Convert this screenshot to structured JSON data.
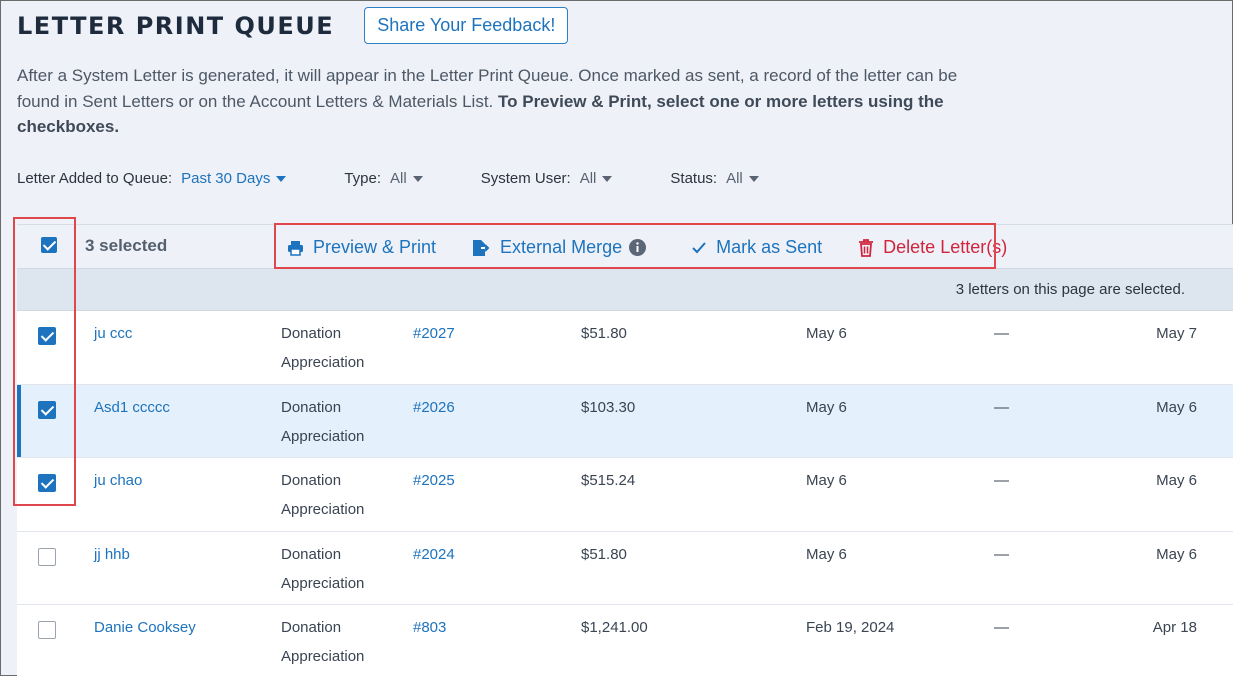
{
  "header": {
    "title": "LETTER PRINT QUEUE",
    "feedback_label": "Share Your Feedback!"
  },
  "description": {
    "text": "After a System Letter is generated, it will appear in the Letter Print Queue. Once marked as sent, a record of the letter can be found in Sent Letters or on the Account Letters & Materials List. ",
    "bold": "To Preview & Print, select one or more letters using the checkboxes."
  },
  "filters": [
    {
      "label": "Letter Added to Queue:",
      "value": "Past 30 Days"
    },
    {
      "label": "Type:",
      "value": "All"
    },
    {
      "label": "System User:",
      "value": "All"
    },
    {
      "label": "Status:",
      "value": "All"
    }
  ],
  "toolbar": {
    "selected_count": "3 selected",
    "preview_print": "Preview & Print",
    "external_merge": "External Merge",
    "mark_sent": "Mark as Sent",
    "delete": "Delete Letter(s)"
  },
  "selection_banner": "3 letters on this page are selected.",
  "rows": [
    {
      "name": "ju ccc",
      "type_line1": "Donation",
      "type_line2": "Appreciation",
      "number": "#2027",
      "amount": "$51.80",
      "date": "May 6",
      "dash": "—",
      "end": "May 7",
      "checked": true
    },
    {
      "name": "Asd1 ccccc",
      "type_line1": "Donation",
      "type_line2": "Appreciation",
      "number": "#2026",
      "amount": "$103.30",
      "date": "May 6",
      "dash": "—",
      "end": "May 6",
      "checked": true
    },
    {
      "name": "ju chao",
      "type_line1": "Donation",
      "type_line2": "Appreciation",
      "number": "#2025",
      "amount": "$515.24",
      "date": "May 6",
      "dash": "—",
      "end": "May 6",
      "checked": true
    },
    {
      "name": "jj hhb",
      "type_line1": "Donation",
      "type_line2": "Appreciation",
      "number": "#2024",
      "amount": "$51.80",
      "date": "May 6",
      "dash": "—",
      "end": "May 6",
      "checked": false
    },
    {
      "name": "Danie Cooksey",
      "type_line1": "Donation",
      "type_line2": "Appreciation",
      "number": "#803",
      "amount": "$1,241.00",
      "date": "Feb 19, 2024",
      "dash": "—",
      "end": "Apr 18",
      "checked": false
    }
  ],
  "colors": {
    "accent": "#1d73bd",
    "danger": "#d0253e",
    "annotation": "#e0474c"
  }
}
